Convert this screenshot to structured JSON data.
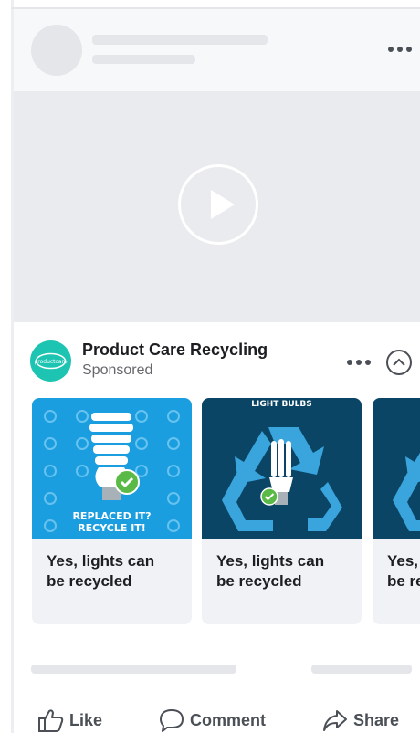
{
  "ad": {
    "advertiser": "Product Care Recycling",
    "label": "Sponsored",
    "logo_text": "productcare"
  },
  "carousel": [
    {
      "caption_line1": "Yes, lights can",
      "caption_line2": "be recycled",
      "overlay_line1": "REPLACED IT?",
      "overlay_line2": "RECYCLE IT!"
    },
    {
      "caption_line1": "Yes, lights can",
      "caption_line2": "be recycled",
      "overlay_title": "LIGHT BULBS"
    },
    {
      "caption_line1": "Yes, lights can",
      "caption_line2": "be recycled"
    }
  ],
  "actions": {
    "like": "Like",
    "comment": "Comment",
    "share": "Share"
  },
  "colors": {
    "brand_teal": "#1dc4b2",
    "card1_bg": "#1a9ee0",
    "card2_bg": "#0b4566",
    "check_green": "#5ab947"
  }
}
